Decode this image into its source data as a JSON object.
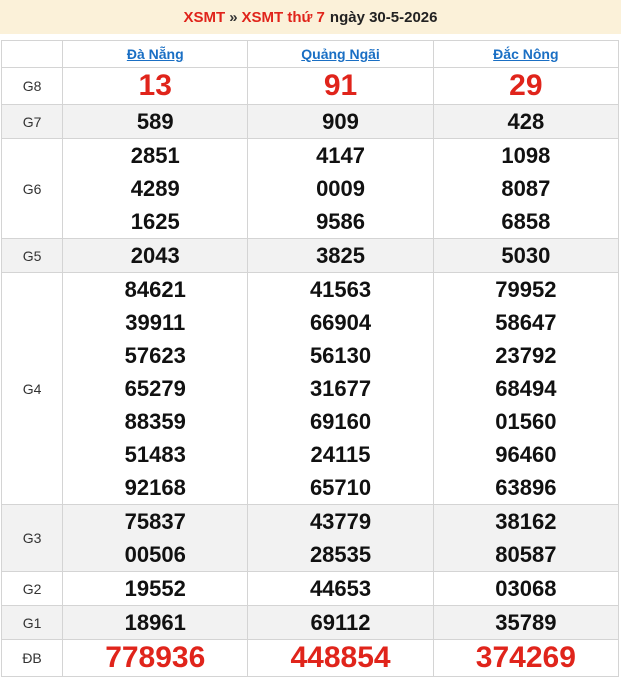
{
  "header": {
    "link1": "XSMT",
    "separator": "»",
    "link2": "XSMT thứ 7",
    "date_text": "ngày 30-5-2026"
  },
  "provinces": [
    "Đà Nẵng",
    "Quảng Ngãi",
    "Đắc Nông"
  ],
  "colors": {
    "accent_red": "#e0241b",
    "link_blue": "#1a6fc4",
    "header_bg": "#fbf1d9"
  },
  "prizes": [
    {
      "label": "G8",
      "values": [
        [
          "13"
        ],
        [
          "91"
        ],
        [
          "29"
        ]
      ]
    },
    {
      "label": "G7",
      "values": [
        [
          "589"
        ],
        [
          "909"
        ],
        [
          "428"
        ]
      ]
    },
    {
      "label": "G6",
      "values": [
        [
          "2851",
          "4289",
          "1625"
        ],
        [
          "4147",
          "0009",
          "9586"
        ],
        [
          "1098",
          "8087",
          "6858"
        ]
      ]
    },
    {
      "label": "G5",
      "values": [
        [
          "2043"
        ],
        [
          "3825"
        ],
        [
          "5030"
        ]
      ]
    },
    {
      "label": "G4",
      "values": [
        [
          "84621",
          "39911",
          "57623",
          "65279",
          "88359",
          "51483",
          "92168"
        ],
        [
          "41563",
          "66904",
          "56130",
          "31677",
          "69160",
          "24115",
          "65710"
        ],
        [
          "79952",
          "58647",
          "23792",
          "68494",
          "01560",
          "96460",
          "63896"
        ]
      ]
    },
    {
      "label": "G3",
      "values": [
        [
          "75837",
          "00506"
        ],
        [
          "43779",
          "28535"
        ],
        [
          "38162",
          "80587"
        ]
      ]
    },
    {
      "label": "G2",
      "values": [
        [
          "19552"
        ],
        [
          "44653"
        ],
        [
          "03068"
        ]
      ]
    },
    {
      "label": "G1",
      "values": [
        [
          "18961"
        ],
        [
          "69112"
        ],
        [
          "35789"
        ]
      ]
    },
    {
      "label": "ĐB",
      "values": [
        [
          "778936"
        ],
        [
          "448854"
        ],
        [
          "374269"
        ]
      ]
    }
  ]
}
